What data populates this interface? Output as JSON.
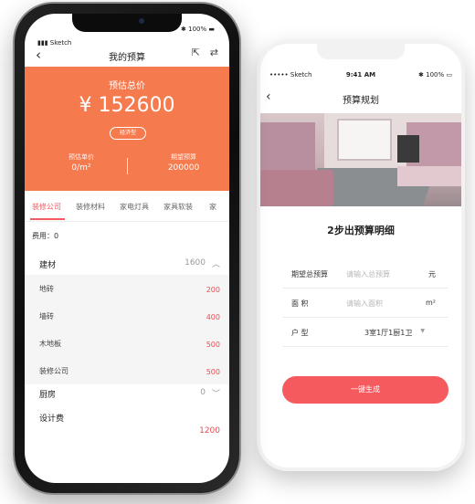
{
  "back_phone": {
    "status_bar": {
      "carrier": "••••• Sketch",
      "time": "9:41 AM",
      "battery": "100%"
    },
    "nav": {
      "title": "预算规划"
    },
    "section_title": "2步出预算明细",
    "form": {
      "budget": {
        "label": "期望总预算",
        "placeholder": "请输入总预算",
        "unit": "元"
      },
      "area": {
        "label": "面 积",
        "placeholder": "请输入面积",
        "unit": "m²"
      },
      "layout": {
        "label": "户 型",
        "value": "3室1厅1厨1卫"
      }
    },
    "generate_button": "一键生成"
  },
  "front_phone": {
    "status_bar": {
      "carrier": "Sketch",
      "battery": "100%"
    },
    "nav": {
      "title": "我的预算"
    },
    "hero": {
      "caption": "预估总价",
      "amount": "¥ 152600",
      "badge": "经济型",
      "unit_price_label": "预估单价",
      "unit_price_value": "0/m²",
      "expected_label": "期望预算",
      "expected_value": "200000"
    },
    "tabs": [
      "装修公司",
      "装修材料",
      "家电灯具",
      "家具软装",
      "家"
    ],
    "fee_label": "费用：0",
    "categories": {
      "jiancai": {
        "name": "建材",
        "total": "1600"
      },
      "chufang": {
        "name": "厨房",
        "total": "0"
      }
    },
    "items": [
      {
        "name": "地砖",
        "value": "200"
      },
      {
        "name": "墙砖",
        "value": "400"
      },
      {
        "name": "木地板",
        "value": "500"
      },
      {
        "name": "装修公司",
        "value": "500"
      }
    ],
    "design_fee": {
      "name": "设计费",
      "value": "1200"
    }
  },
  "colors": {
    "accent_orange": "#f57a4e",
    "accent_red": "#f55a5f"
  }
}
